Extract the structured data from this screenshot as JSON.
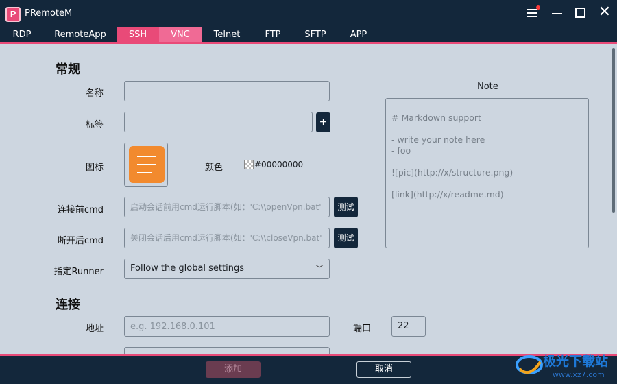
{
  "app": {
    "title": "PRemoteM",
    "logo_letter": "P"
  },
  "tabs": [
    "RDP",
    "RemoteApp",
    "SSH",
    "VNC",
    "Telnet",
    "FTP",
    "SFTP",
    "APP"
  ],
  "general": {
    "section_title": "常规",
    "name_label": "名称",
    "name_value": "",
    "tag_label": "标签",
    "tag_value": "",
    "tag_add_button": "+",
    "icon_label": "图标",
    "color_label": "颜色",
    "color_value": "#00000000",
    "pre_cmd_label": "连接前cmd",
    "pre_cmd_placeholder": "启动会话前用cmd运行脚本(如：'C:\\\\openVpn.bat' *",
    "post_cmd_label": "断开后cmd",
    "post_cmd_placeholder": "关闭会话后用cmd运行脚本(如：'C:\\\\closeVpn.bat' *",
    "test_button": "测试",
    "runner_label": "指定Runner",
    "runner_value": "Follow the global settings"
  },
  "note": {
    "label": "Note",
    "placeholder": "# Markdown support\n\n- write your note here\n- foo\n\n![pic](http://x/structure.png)\n\n[link](http://x/readme.md)"
  },
  "connection": {
    "section_title": "连接",
    "address_label": "地址",
    "address_placeholder": "e.g. 192.168.0.101",
    "port_label": "端口",
    "port_value": "22"
  },
  "footer": {
    "add_button": "添加",
    "cancel_button": "取消"
  },
  "watermark": {
    "text": "极光下载站",
    "url": "www.xz7.com"
  },
  "colors": {
    "accent": "#e94a78",
    "dark": "#13273b",
    "panel": "#cdd6e0",
    "icon_orange": "#f28a2e"
  }
}
